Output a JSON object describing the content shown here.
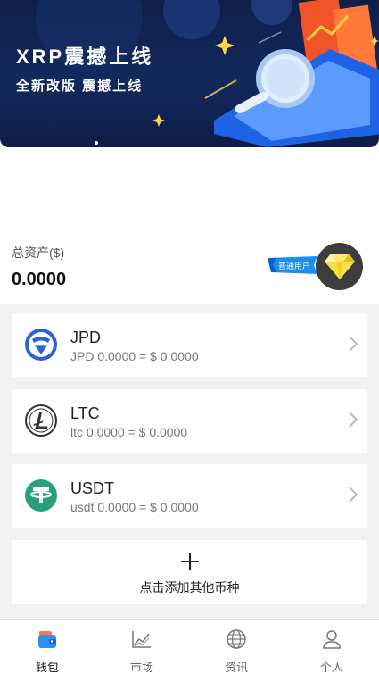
{
  "banner": {
    "title": "XRP震撼上线",
    "subtitle": "全新改版 震撼上线"
  },
  "assets": {
    "label": "总资产($)",
    "value": "0.0000",
    "badge_label": "普通用户",
    "badge_icon": "diamond-icon"
  },
  "coins": [
    {
      "name": "JPD",
      "balance": "JPD 0.0000 = $ 0.0000",
      "icon": "jpd-logo-icon",
      "color": "#2b63d6"
    },
    {
      "name": "LTC",
      "balance": "ltc 0.0000 = $ 0.0000",
      "icon": "litecoin-icon",
      "color": "#333333"
    },
    {
      "name": "USDT",
      "balance": "usdt 0.0000 = $ 0.0000",
      "icon": "tether-icon",
      "color": "#26a17b"
    }
  ],
  "add_coin": {
    "label": "点击添加其他币种",
    "icon": "plus-icon"
  },
  "tabs": [
    {
      "label": "钱包",
      "icon": "wallet-icon",
      "active": true
    },
    {
      "label": "市场",
      "icon": "chart-icon",
      "active": false
    },
    {
      "label": "资讯",
      "icon": "globe-icon",
      "active": false
    },
    {
      "label": "个人",
      "icon": "user-icon",
      "active": false
    }
  ],
  "colors": {
    "banner_bg": "#13285c",
    "list_bg": "#f2f2f2",
    "badge_bg": "#3d3d3d",
    "badge_tag": "#1a8ff0"
  }
}
